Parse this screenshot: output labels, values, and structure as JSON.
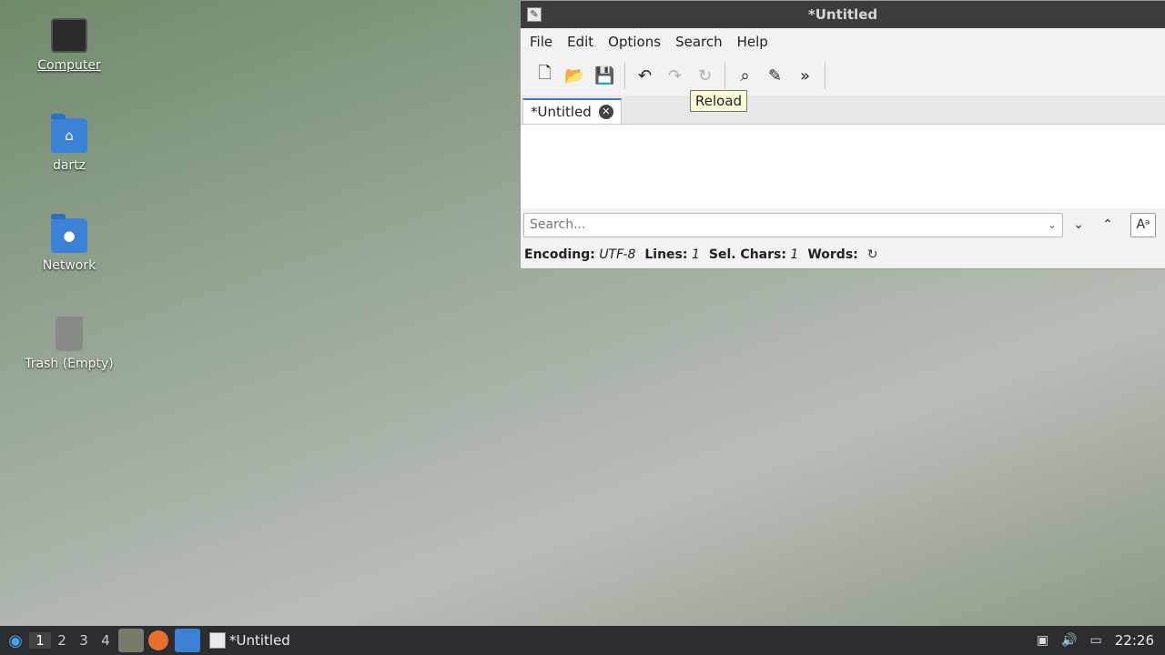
{
  "desktop": {
    "icons": [
      {
        "label": "Computer"
      },
      {
        "label": "dartz"
      },
      {
        "label": "Network"
      },
      {
        "label": "Trash (Empty)"
      }
    ]
  },
  "window": {
    "title": "*Untitled",
    "menu": [
      "File",
      "Edit",
      "Options",
      "Search",
      "Help"
    ],
    "tooltip": "Reload",
    "tab_label": "*Untitled",
    "editor_text": "",
    "search_placeholder": "Search...",
    "status": {
      "encoding_label": "Encoding:",
      "encoding_value": "UTF-8",
      "lines_label": "Lines:",
      "lines_value": "1",
      "sel_label": "Sel. Chars:",
      "sel_value": "1",
      "words_label": "Words:"
    }
  },
  "taskbar": {
    "workspaces": [
      "1",
      "2",
      "3",
      "4"
    ],
    "task_label": "*Untitled",
    "clock": "22:26"
  }
}
